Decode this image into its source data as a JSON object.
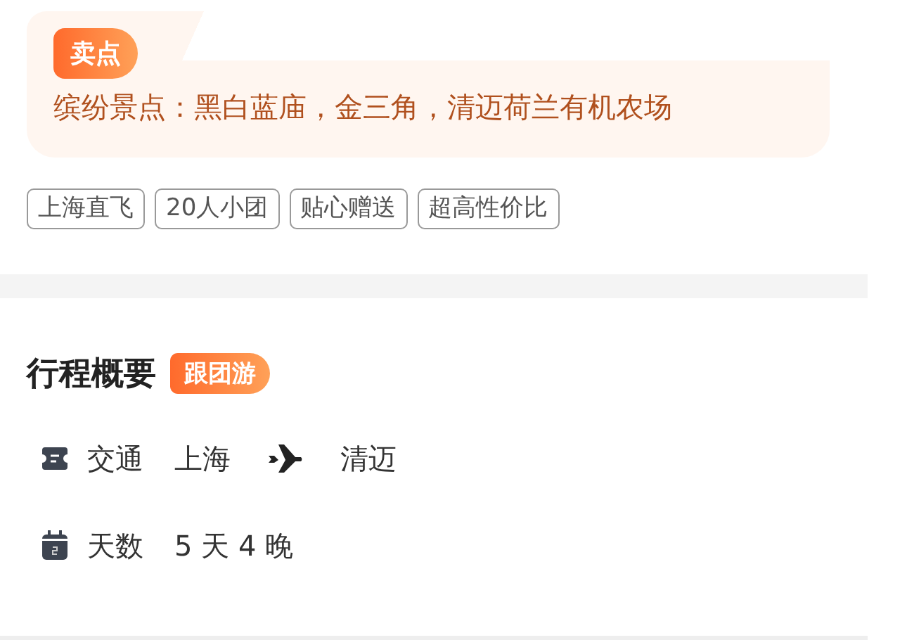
{
  "selling_point": {
    "badge": "卖点",
    "text": "缤纷景点：黑白蓝庙，金三角，清迈荷兰有机农场"
  },
  "tags": [
    "上海直飞",
    "20人小团",
    "贴心赠送",
    "超高性价比"
  ],
  "overview": {
    "title": "行程概要",
    "badge": "跟团游",
    "rows": [
      {
        "kind": "route",
        "label": "交通",
        "from": "上海",
        "to": "清迈"
      },
      {
        "kind": "duration",
        "label": "天数",
        "value": "5 天 4 晚"
      }
    ]
  }
}
